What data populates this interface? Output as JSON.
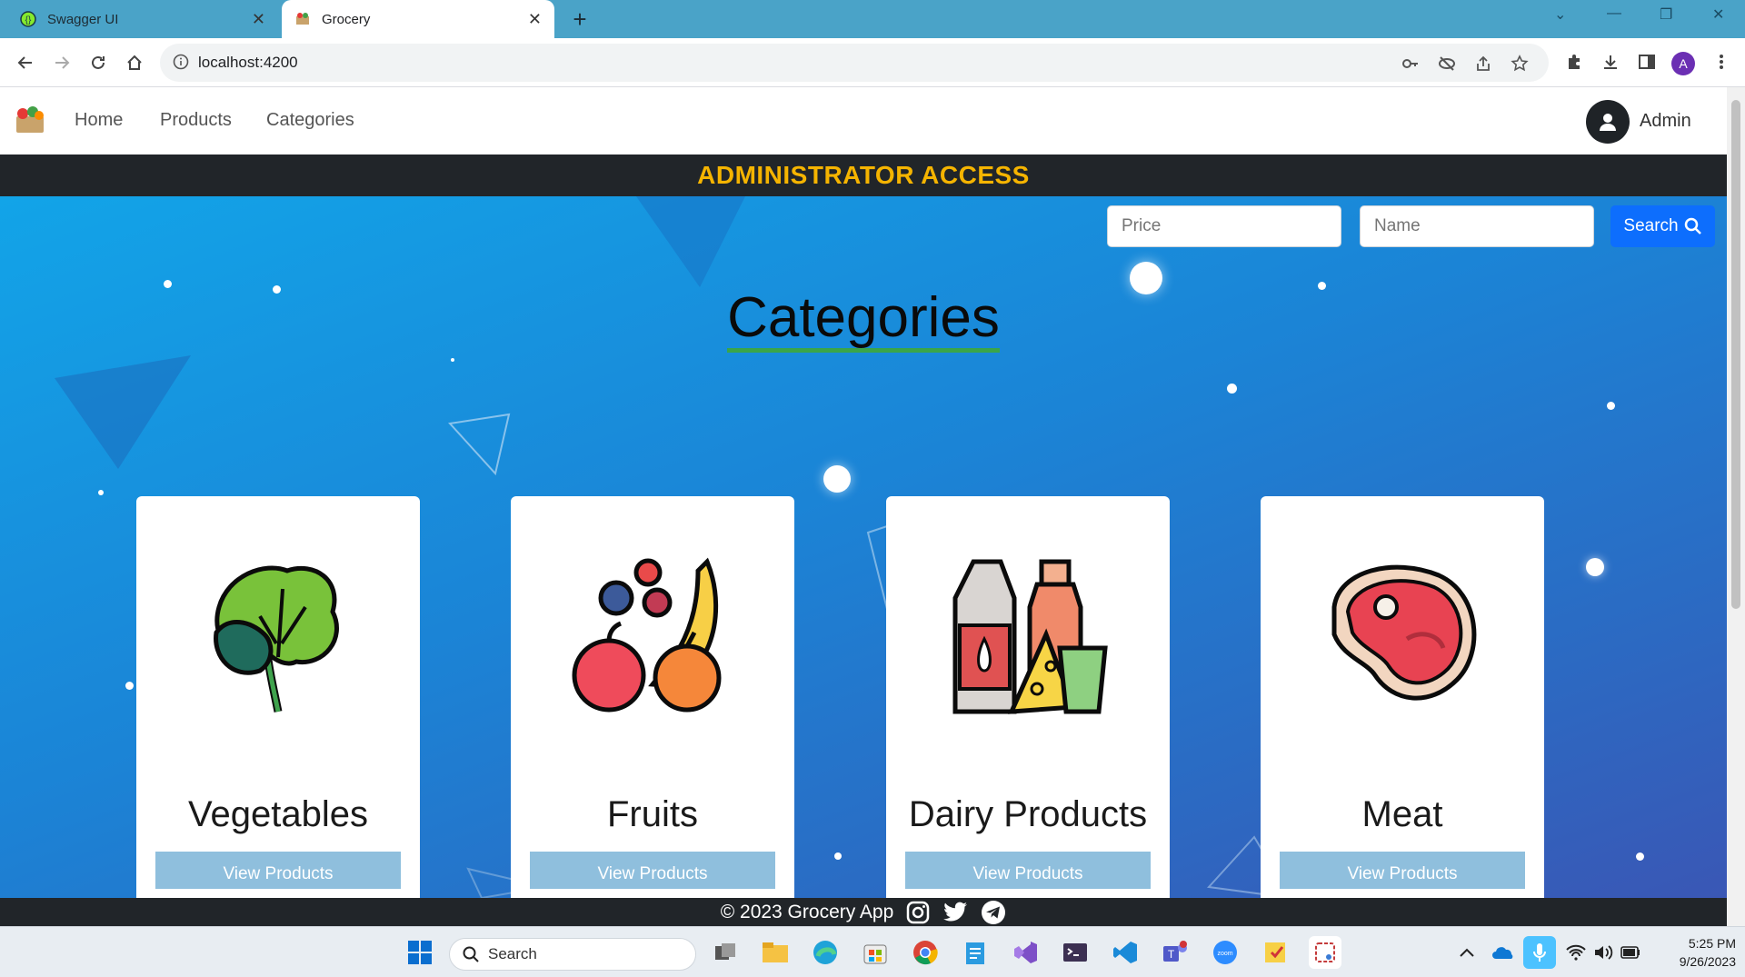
{
  "browser": {
    "tabs": [
      {
        "title": "Swagger UI",
        "active": false
      },
      {
        "title": "Grocery",
        "active": true
      }
    ],
    "url": "localhost:4200",
    "profile_initial": "A"
  },
  "navbar": {
    "links": [
      "Home",
      "Products",
      "Categories"
    ],
    "user_name": "Admin"
  },
  "banner": {
    "text": "ADMINISTRATOR ACCESS"
  },
  "search": {
    "price_placeholder": "Price",
    "name_placeholder": "Name",
    "button_label": "Search"
  },
  "page": {
    "title": "Categories"
  },
  "categories": [
    {
      "name": "Vegetables",
      "button": "View Products",
      "icon": "vegetable-icon"
    },
    {
      "name": "Fruits",
      "button": "View Products",
      "icon": "fruits-icon"
    },
    {
      "name": "Dairy Products",
      "button": "View Products",
      "icon": "dairy-icon"
    },
    {
      "name": "Meat",
      "button": "View Products",
      "icon": "meat-icon"
    }
  ],
  "footer": {
    "text": "© 2023 Grocery App",
    "social_icons": [
      "instagram-icon",
      "twitter-icon",
      "telegram-icon"
    ]
  },
  "taskbar": {
    "search_label": "Search",
    "time": "5:25 PM",
    "date": "9/26/2023"
  },
  "colors": {
    "banner_text": "#f5b400",
    "search_button": "#0d6efd",
    "card_button": "#8fbfdd",
    "title_underline": "#3aa54a"
  }
}
